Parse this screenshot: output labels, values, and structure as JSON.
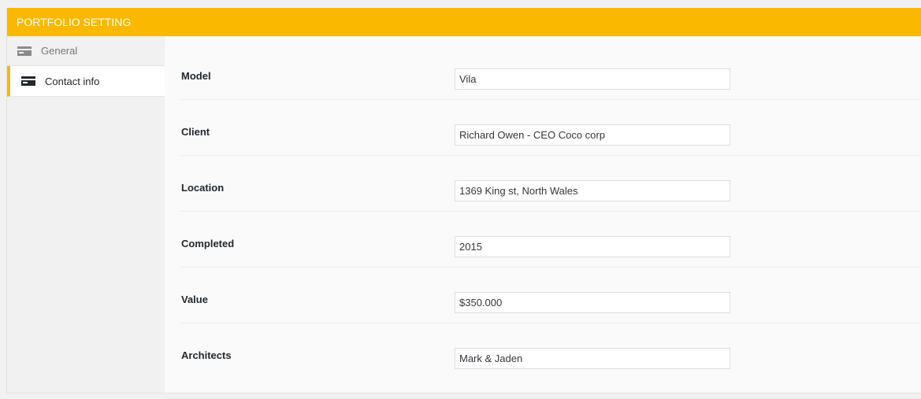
{
  "header": {
    "title": "PORTFOLIO SETTING"
  },
  "sidebar": {
    "tabs": [
      {
        "label": "General",
        "icon": "card-icon"
      },
      {
        "label": "Contact info",
        "icon": "card-icon"
      }
    ]
  },
  "fields": [
    {
      "label": "Model",
      "value": "Vila"
    },
    {
      "label": "Client",
      "value": "Richard Owen - CEO Coco corp"
    },
    {
      "label": "Location",
      "value": "1369 King st, North Wales"
    },
    {
      "label": "Completed",
      "value": "2015"
    },
    {
      "label": "Value",
      "value": "$350.000"
    },
    {
      "label": "Architects",
      "value": "Mark & Jaden"
    }
  ],
  "colors": {
    "accent": "#fab800"
  }
}
